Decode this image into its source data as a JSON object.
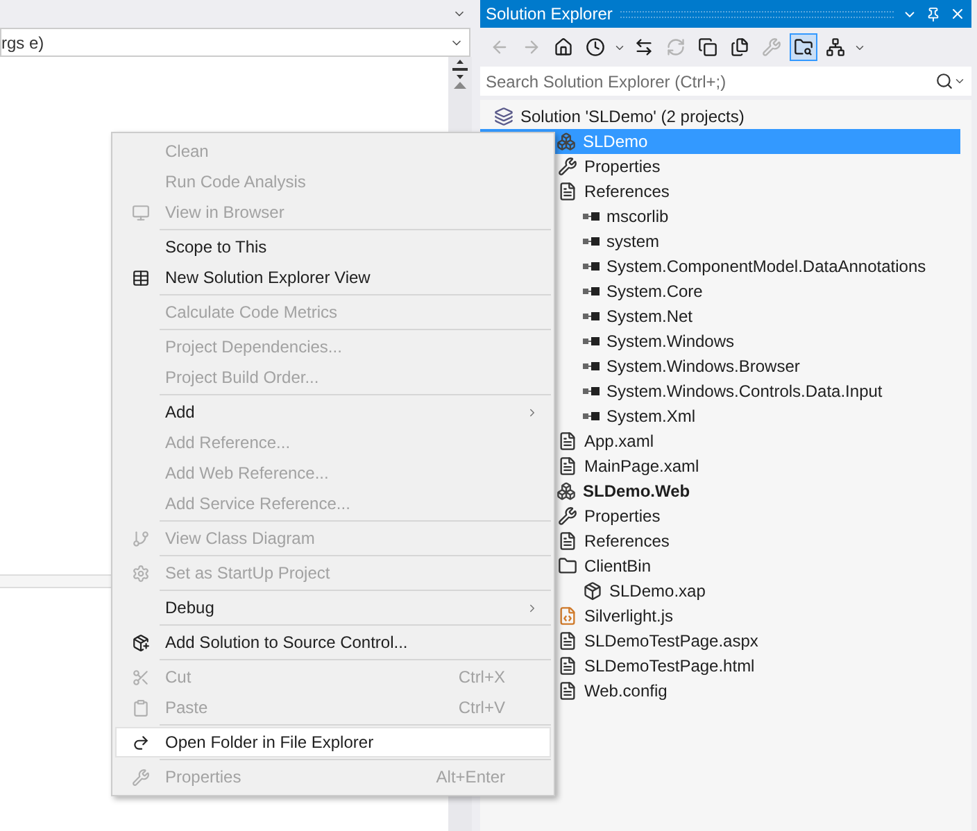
{
  "editor": {
    "member_dropdown": {
      "value": "rgs e)"
    }
  },
  "solution_explorer": {
    "title": "Solution Explorer",
    "toolbar": [
      {
        "disabled": true,
        "pressed": false
      },
      {
        "disabled": true,
        "pressed": false
      },
      {
        "disabled": false,
        "pressed": false
      },
      {
        "disabled": false,
        "pressed": false
      },
      {
        "disabled": false,
        "pressed": false
      },
      {
        "disabled": true,
        "pressed": false
      },
      {
        "disabled": false,
        "pressed": false
      },
      {
        "disabled": false,
        "pressed": false
      },
      {
        "disabled": true,
        "pressed": false
      },
      {
        "disabled": false,
        "pressed": true
      },
      {
        "disabled": false,
        "pressed": false
      }
    ],
    "search": {
      "placeholder": "Search Solution Explorer (Ctrl+;)"
    },
    "tree": [
      {
        "label": "Solution 'SLDemo' (2 projects)",
        "kind": "solution",
        "selected": false,
        "bold": false,
        "children": [
          {
            "label": "SLDemo",
            "kind": "project",
            "selected": true,
            "bold": false,
            "children": [
              {
                "label": "Properties",
                "kind": "properties",
                "selected": false,
                "bold": false
              },
              {
                "label": "References",
                "kind": "references",
                "selected": false,
                "bold": false,
                "children": [
                  {
                    "label": "mscorlib",
                    "kind": "reference",
                    "selected": false,
                    "bold": false
                  },
                  {
                    "label": "system",
                    "kind": "reference",
                    "selected": false,
                    "bold": false
                  },
                  {
                    "label": "System.ComponentModel.DataAnnotations",
                    "kind": "reference",
                    "selected": false,
                    "bold": false
                  },
                  {
                    "label": "System.Core",
                    "kind": "reference",
                    "selected": false,
                    "bold": false
                  },
                  {
                    "label": "System.Net",
                    "kind": "reference",
                    "selected": false,
                    "bold": false
                  },
                  {
                    "label": "System.Windows",
                    "kind": "reference",
                    "selected": false,
                    "bold": false
                  },
                  {
                    "label": "System.Windows.Browser",
                    "kind": "reference",
                    "selected": false,
                    "bold": false
                  },
                  {
                    "label": "System.Windows.Controls.Data.Input",
                    "kind": "reference",
                    "selected": false,
                    "bold": false
                  },
                  {
                    "label": "System.Xml",
                    "kind": "reference",
                    "selected": false,
                    "bold": false
                  }
                ]
              },
              {
                "label": "App.xaml",
                "kind": "file",
                "selected": false,
                "bold": false
              },
              {
                "label": "MainPage.xaml",
                "kind": "file",
                "selected": false,
                "bold": false
              }
            ]
          },
          {
            "label": "SLDemo.Web",
            "kind": "project",
            "selected": false,
            "bold": true,
            "children": [
              {
                "label": "Properties",
                "kind": "properties",
                "selected": false,
                "bold": false
              },
              {
                "label": "References",
                "kind": "references",
                "selected": false,
                "bold": false
              },
              {
                "label": "ClientBin",
                "kind": "folder",
                "selected": false,
                "bold": false,
                "children": [
                  {
                    "label": "SLDemo.xap",
                    "kind": "package",
                    "selected": false,
                    "bold": false
                  }
                ]
              },
              {
                "label": "Silverlight.js",
                "kind": "script",
                "selected": false,
                "bold": false
              },
              {
                "label": "SLDemoTestPage.aspx",
                "kind": "file",
                "selected": false,
                "bold": false
              },
              {
                "label": "SLDemoTestPage.html",
                "kind": "file",
                "selected": false,
                "bold": false
              },
              {
                "label": "Web.config",
                "kind": "file",
                "selected": false,
                "bold": false
              }
            ]
          }
        ]
      }
    ]
  },
  "context_menu": [
    {
      "kind": "item",
      "label": "Clean",
      "disabled": true,
      "selected": false
    },
    {
      "kind": "item",
      "label": "Run Code Analysis",
      "disabled": true,
      "selected": false
    },
    {
      "kind": "item",
      "label": "View in Browser",
      "disabled": true,
      "selected": false
    },
    {
      "kind": "separator"
    },
    {
      "kind": "item",
      "label": "Scope to This",
      "disabled": false,
      "selected": false
    },
    {
      "kind": "item",
      "label": "New Solution Explorer View",
      "disabled": false,
      "selected": false
    },
    {
      "kind": "separator"
    },
    {
      "kind": "item",
      "label": "Calculate Code Metrics",
      "disabled": true,
      "selected": false
    },
    {
      "kind": "separator"
    },
    {
      "kind": "item",
      "label": "Project Dependencies...",
      "disabled": true,
      "selected": false
    },
    {
      "kind": "item",
      "label": "Project Build Order...",
      "disabled": true,
      "selected": false
    },
    {
      "kind": "separator"
    },
    {
      "kind": "submenu",
      "label": "Add",
      "disabled": false,
      "selected": false
    },
    {
      "kind": "item",
      "label": "Add Reference...",
      "disabled": true,
      "selected": false
    },
    {
      "kind": "item",
      "label": "Add Web Reference...",
      "disabled": true,
      "selected": false
    },
    {
      "kind": "item",
      "label": "Add Service Reference...",
      "disabled": true,
      "selected": false
    },
    {
      "kind": "separator"
    },
    {
      "kind": "item",
      "label": "View Class Diagram",
      "disabled": true,
      "selected": false
    },
    {
      "kind": "separator"
    },
    {
      "kind": "item",
      "label": "Set as StartUp Project",
      "disabled": true,
      "selected": false
    },
    {
      "kind": "separator"
    },
    {
      "kind": "submenu",
      "label": "Debug",
      "disabled": false,
      "selected": false
    },
    {
      "kind": "separator"
    },
    {
      "kind": "item",
      "label": "Add Solution to Source Control...",
      "disabled": false,
      "selected": false
    },
    {
      "kind": "separator"
    },
    {
      "kind": "item",
      "label": "Cut",
      "shortcut": "Ctrl+X",
      "disabled": true,
      "selected": false
    },
    {
      "kind": "item",
      "label": "Paste",
      "shortcut": "Ctrl+V",
      "disabled": true,
      "selected": false
    },
    {
      "kind": "separator"
    },
    {
      "kind": "item",
      "label": "Open Folder in File Explorer",
      "disabled": false,
      "selected": true
    },
    {
      "kind": "separator"
    },
    {
      "kind": "item",
      "label": "Properties",
      "shortcut": "Alt+Enter",
      "disabled": true,
      "selected": false
    }
  ]
}
